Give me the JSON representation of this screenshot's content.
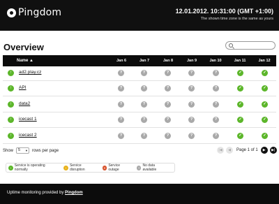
{
  "header": {
    "logo": "Pingdom",
    "time": "12.01.2012. 10:31:00 (GMT +1:00)",
    "time_note": "The shown time zone is the same as yours"
  },
  "overview": {
    "title": "Overview",
    "search_placeholder": ""
  },
  "table": {
    "name_header": "Name ▲",
    "days": [
      "Jan 6",
      "Jan 7",
      "Jan 8",
      "Jan 9",
      "Jan 10",
      "Jan 11",
      "Jan 12"
    ],
    "rows": [
      {
        "name": "ad2.play.cz",
        "status": "up",
        "days": [
          "no data",
          "no data",
          "no data",
          "no data",
          "no data",
          "up",
          "up"
        ]
      },
      {
        "name": "API",
        "status": "up",
        "days": [
          "no data",
          "no data",
          "no data",
          "no data",
          "no data",
          "up",
          "up"
        ]
      },
      {
        "name": "data2",
        "status": "up",
        "days": [
          "no data",
          "no data",
          "no data",
          "no data",
          "no data",
          "up",
          "up"
        ]
      },
      {
        "name": "icecast 1",
        "status": "up",
        "days": [
          "no data",
          "no data",
          "no data",
          "no data",
          "no data",
          "up",
          "up"
        ]
      },
      {
        "name": "icecast 2",
        "status": "up",
        "days": [
          "no data",
          "no data",
          "no data",
          "no data",
          "no data",
          "up",
          "up"
        ]
      }
    ]
  },
  "pager": {
    "show_label": "Show",
    "rows_value": "5",
    "rows_label": "rows per page",
    "page_text": "Page 1 of 1"
  },
  "legend": {
    "ok": "Service is operating normally",
    "disruption": "Service disruption",
    "outage": "Service outage",
    "nodata": "No data available"
  },
  "footer": {
    "prefix": "Uptime monitoring provided by ",
    "link": "Pingdom"
  },
  "colors": {
    "up": "#5cb62a",
    "nodata": "#a9a9a9",
    "disruption": "#e8b21c",
    "outage": "#d8512a",
    "bar": "#0c0c0c"
  }
}
